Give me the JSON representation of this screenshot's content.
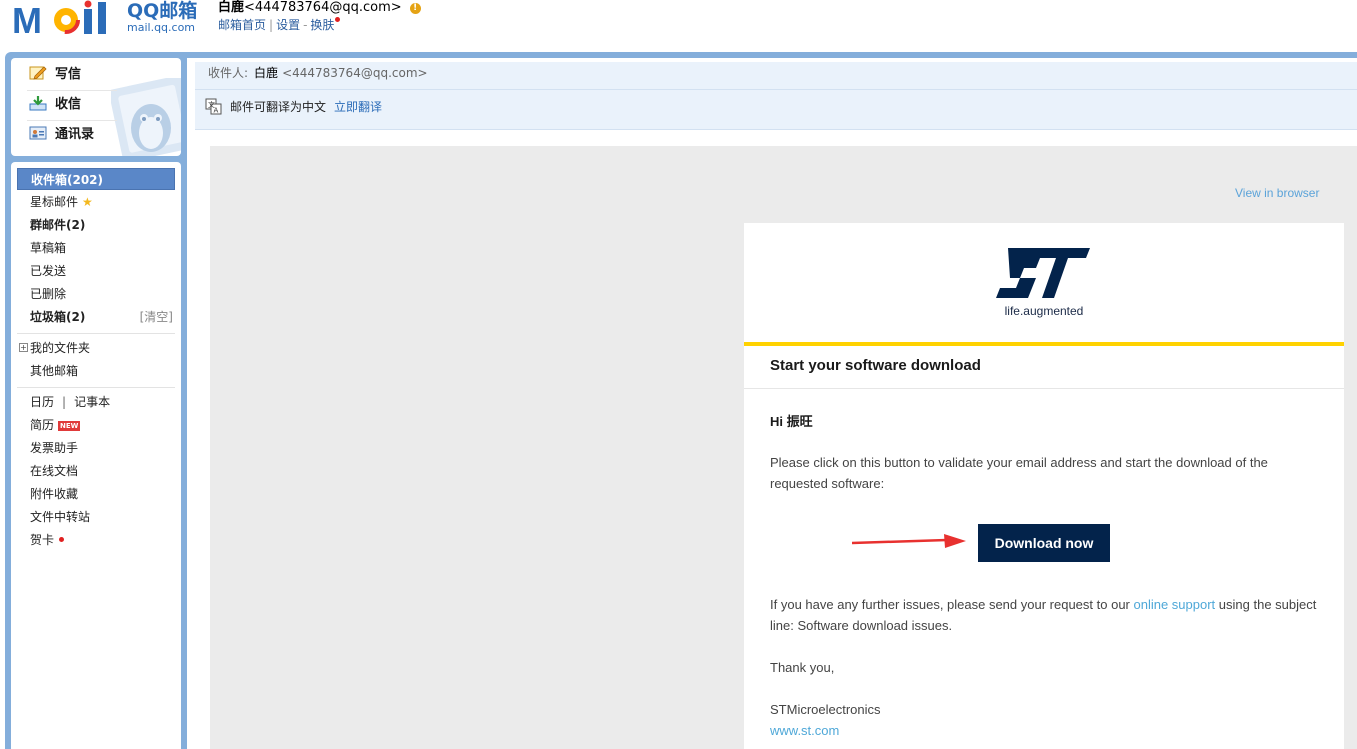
{
  "header": {
    "logo_text_main": "QQ邮箱",
    "logo_text_sub": "mail.qq.com",
    "user_name": "白鹿",
    "user_email": "<444783764@qq.com>",
    "links": [
      "邮箱首页",
      "设置",
      "换肤"
    ],
    "separators": [
      "|",
      "-"
    ]
  },
  "nav": {
    "actions": [
      {
        "label": "写信",
        "icon": "compose-icon"
      },
      {
        "label": "收信",
        "icon": "receive-icon"
      },
      {
        "label": "通讯录",
        "icon": "contacts-icon"
      }
    ],
    "folders": {
      "inbox": "收件箱(202)",
      "starred": "星标邮件",
      "group": "群邮件(2)",
      "drafts": "草稿箱",
      "sent": "已发送",
      "deleted": "已删除",
      "spam": "垃圾箱(2)",
      "spam_clear": "[清空]",
      "my_folders": "我的文件夹",
      "other_mailboxes": "其他邮箱",
      "calendar": "日历",
      "pipe": "|",
      "notes": "记事本",
      "resume": "简历",
      "resume_badge": "NEW",
      "invoice": "发票助手",
      "online_docs": "在线文档",
      "attachments": "附件收藏",
      "file_transfer": "文件中转站",
      "greeting_card": "贺卡"
    },
    "expand_symbol": "+"
  },
  "message": {
    "recipient_label": "收件人:",
    "recipient_name": "白鹿",
    "recipient_email": "<444783764@qq.com>",
    "translate_prompt": "邮件可翻译为中文",
    "translate_link": "立即翻译"
  },
  "email": {
    "view_in_browser": "View in browser",
    "logo_tagline": "life.augmented",
    "title": "Start your software download",
    "greeting": "Hi 振旺",
    "para1": "Please click on this button to validate your email address and start the download of the requested software:",
    "button": "Download now",
    "para2_before": "If you have any further issues, please send your request to our ",
    "para2_link": "online support",
    "para2_after": " using the subject line: Software download issues.",
    "thanks": "Thank you,",
    "signature": "STMicroelectronics",
    "website": "www.st.com"
  },
  "colors": {
    "brand_blue": "#2b6cb8",
    "frame_blue": "#84aedb",
    "st_navy": "#03234b",
    "st_yellow": "#ffd200",
    "link_blue": "#4fa8d8",
    "arrow_red": "#e8312f"
  }
}
